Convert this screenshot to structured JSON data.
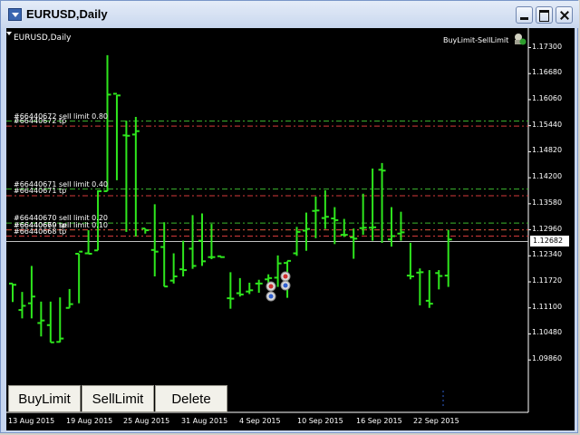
{
  "window": {
    "title": "EURUSD,Daily"
  },
  "chart": {
    "symbol_label": "EURUSD,Daily",
    "ea_name": "BuyLimit-SellLimit",
    "current_price": "1.12682",
    "price_ticks": [
      "1.17300",
      "1.16680",
      "1.16060",
      "1.15440",
      "1.14820",
      "1.14200",
      "1.13580",
      "1.12960",
      "1.12340",
      "1.11720",
      "1.11100",
      "1.10480",
      "1.09860"
    ],
    "date_ticks": [
      "13 Aug 2015",
      "19 Aug 2015",
      "25 Aug 2015",
      "31 Aug 2015",
      "4 Sep 2015",
      "10 Sep 2015",
      "16 Sep 2015",
      "22 Sep 2015"
    ],
    "order_lines": [
      {
        "label": "#66440672 sell limit 0.80",
        "price": 1.1555,
        "color": "#3cb82f"
      },
      {
        "label": "#66440672 tp",
        "price": 1.1543,
        "color": "#d43a3a"
      },
      {
        "label": "#66440671 sell limit 0.40",
        "price": 1.1393,
        "color": "#3cb82f"
      },
      {
        "label": "#66440671 tp",
        "price": 1.1377,
        "color": "#d43a3a"
      },
      {
        "label": "#66440670 sell limit 0.20",
        "price": 1.1312,
        "color": "#3cb82f"
      },
      {
        "label": "#66440669 sell limit 0.10",
        "price": 1.1296,
        "color": "#3cb82f"
      },
      {
        "label": "#66440670 tp",
        "price": 1.1296,
        "color": "#d43a3a"
      },
      {
        "label": "#66440668 tp",
        "price": 1.1281,
        "color": "#d43a3a"
      }
    ],
    "buttons": {
      "buy_limit": "BuyLimit",
      "sell_limit": "SellLimit",
      "delete": "Delete"
    },
    "colors": {
      "bars": "#2ee61d",
      "background": "#000000",
      "grid": "#ffffff"
    }
  },
  "chart_data": {
    "type": "ohlc",
    "title": "EURUSD,Daily",
    "ylim": [
      1.0926,
      1.1757
    ],
    "bars": [
      {
        "o": 1.1168,
        "h": 1.1168,
        "l": 1.1124,
        "c": 1.1165
      },
      {
        "o": 1.1105,
        "h": 1.1148,
        "l": 1.1085,
        "c": 1.1115
      },
      {
        "o": 1.1121,
        "h": 1.121,
        "l": 1.1085,
        "c": 1.1137
      },
      {
        "o": 1.1074,
        "h": 1.1125,
        "l": 1.1042,
        "c": 1.108
      },
      {
        "o": 1.1069,
        "h": 1.1125,
        "l": 1.1028,
        "c": 1.1028
      },
      {
        "o": 1.1029,
        "h": 1.1135,
        "l": 1.1028,
        "c": 1.1037
      },
      {
        "o": 1.111,
        "h": 1.1155,
        "l": 1.111,
        "c": 1.1119
      },
      {
        "o": 1.1239,
        "h": 1.1239,
        "l": 1.1121,
        "c": 1.1244
      },
      {
        "o": 1.124,
        "h": 1.1295,
        "l": 1.124,
        "c": 1.1239
      },
      {
        "o": 1.1247,
        "h": 1.139,
        "l": 1.1247,
        "c": 1.1388
      },
      {
        "o": 1.1388,
        "h": 1.1712,
        "l": 1.1388,
        "c": 1.1618
      },
      {
        "o": 1.162,
        "h": 1.1617,
        "l": 1.1414,
        "c": 1.1616
      },
      {
        "o": 1.1521,
        "h": 1.1556,
        "l": 1.1291,
        "c": 1.152
      },
      {
        "o": 1.1523,
        "h": 1.1565,
        "l": 1.128,
        "c": 1.1531
      },
      {
        "o": 1.1299,
        "h": 1.1299,
        "l": 1.1287,
        "c": 1.1295
      },
      {
        "o": 1.1248,
        "h": 1.1357,
        "l": 1.1185,
        "c": 1.1244
      },
      {
        "o": 1.1255,
        "h": 1.1314,
        "l": 1.1161,
        "c": 1.1161
      },
      {
        "o": 1.1175,
        "h": 1.124,
        "l": 1.1168,
        "c": 1.1185
      },
      {
        "o": 1.1202,
        "h": 1.127,
        "l": 1.1185,
        "c": 1.12
      },
      {
        "o": 1.1251,
        "h": 1.1331,
        "l": 1.1203,
        "c": 1.121
      },
      {
        "o": 1.127,
        "h": 1.1335,
        "l": 1.121,
        "c": 1.1221
      },
      {
        "o": 1.1231,
        "h": 1.131,
        "l": 1.1226,
        "c": 1.1231
      },
      {
        "o": 1.1233,
        "h": 1.1233,
        "l": 1.1229,
        "c": 1.1231
      },
      {
        "o": 1.1133,
        "h": 1.1195,
        "l": 1.1108,
        "c": 1.1132
      },
      {
        "o": 1.1145,
        "h": 1.1181,
        "l": 1.1137,
        "c": 1.1142
      },
      {
        "o": 1.1149,
        "h": 1.117,
        "l": 1.1143,
        "c": 1.1152
      },
      {
        "o": 1.1168,
        "h": 1.1177,
        "l": 1.1146,
        "c": 1.1168
      },
      {
        "o": 1.1178,
        "h": 1.119,
        "l": 1.1164,
        "c": 1.1181
      },
      {
        "o": 1.1182,
        "h": 1.1235,
        "l": 1.116,
        "c": 1.1216
      },
      {
        "o": 1.1217,
        "h": 1.1221,
        "l": 1.1134,
        "c": 1.1222
      },
      {
        "o": 1.124,
        "h": 1.1303,
        "l": 1.1234,
        "c": 1.1291
      },
      {
        "o": 1.1294,
        "h": 1.1337,
        "l": 1.1246,
        "c": 1.1298
      },
      {
        "o": 1.1341,
        "h": 1.1375,
        "l": 1.1276,
        "c": 1.1342
      },
      {
        "o": 1.1324,
        "h": 1.139,
        "l": 1.1298,
        "c": 1.1327
      },
      {
        "o": 1.1323,
        "h": 1.135,
        "l": 1.1262,
        "c": 1.1319
      },
      {
        "o": 1.1284,
        "h": 1.1322,
        "l": 1.1279,
        "c": 1.1284
      },
      {
        "o": 1.1278,
        "h": 1.1299,
        "l": 1.1227,
        "c": 1.1275
      },
      {
        "o": 1.13,
        "h": 1.1382,
        "l": 1.1284,
        "c": 1.1301
      },
      {
        "o": 1.1301,
        "h": 1.1442,
        "l": 1.127,
        "c": 1.1302
      },
      {
        "o": 1.1439,
        "h": 1.1455,
        "l": 1.1265,
        "c": 1.1437
      },
      {
        "o": 1.1273,
        "h": 1.135,
        "l": 1.1256,
        "c": 1.1281
      },
      {
        "o": 1.1287,
        "h": 1.1339,
        "l": 1.127,
        "c": 1.129
      },
      {
        "o": 1.1187,
        "h": 1.1265,
        "l": 1.1178,
        "c": 1.1185
      },
      {
        "o": 1.1194,
        "h": 1.1204,
        "l": 1.1116,
        "c": 1.1195
      },
      {
        "o": 1.1127,
        "h": 1.12,
        "l": 1.111,
        "c": 1.112
      },
      {
        "o": 1.1193,
        "h": 1.12,
        "l": 1.1154,
        "c": 1.1186
      },
      {
        "o": 1.1187,
        "h": 1.1296,
        "l": 1.116,
        "c": 1.1273
      }
    ]
  }
}
